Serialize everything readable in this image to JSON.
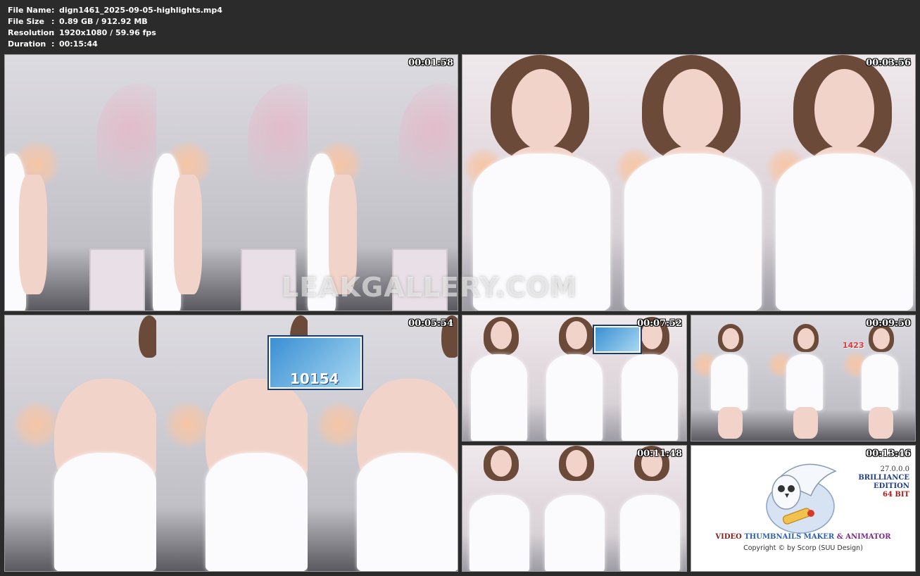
{
  "info": {
    "file_name_label": "File Name",
    "file_name": "dign1461_2025-09-05-highlights.mp4",
    "file_size_label": "File Size",
    "file_size": "0.89 GB / 912.92 MB",
    "resolution_label": "Resolution",
    "resolution": "1920x1080 / 59.96 fps",
    "duration_label": "Duration",
    "duration": "00:15:44",
    "separator": ":"
  },
  "thumbnails": [
    {
      "timestamp": "00:01:58"
    },
    {
      "timestamp": "00:03:56"
    },
    {
      "timestamp": "00:05:54",
      "overlay_number": "10154"
    },
    {
      "timestamp": "00:07:52"
    },
    {
      "timestamp": "00:09:50",
      "overlay_number": "1423"
    },
    {
      "timestamp": "00:11:48"
    },
    {
      "timestamp": "00:13:46"
    }
  ],
  "watermark": "LEAKGALLERY.COM",
  "logo": {
    "version": "27.0.0.0",
    "edition_line1": "BRILLIANCE",
    "edition_line2": "EDITION",
    "bits": "64 BIT",
    "title_word1": "VIDEO",
    "title_word2": "THUMBNAILS MAKER",
    "title_word3": "& ANIMATOR",
    "copyright": "Copyright © by Scorp (SUU Design)"
  },
  "colors": {
    "background": "#2b2b2b",
    "border": "#9a9a9a",
    "brilliance": "#1f3f8c",
    "bits": "#b01818"
  }
}
